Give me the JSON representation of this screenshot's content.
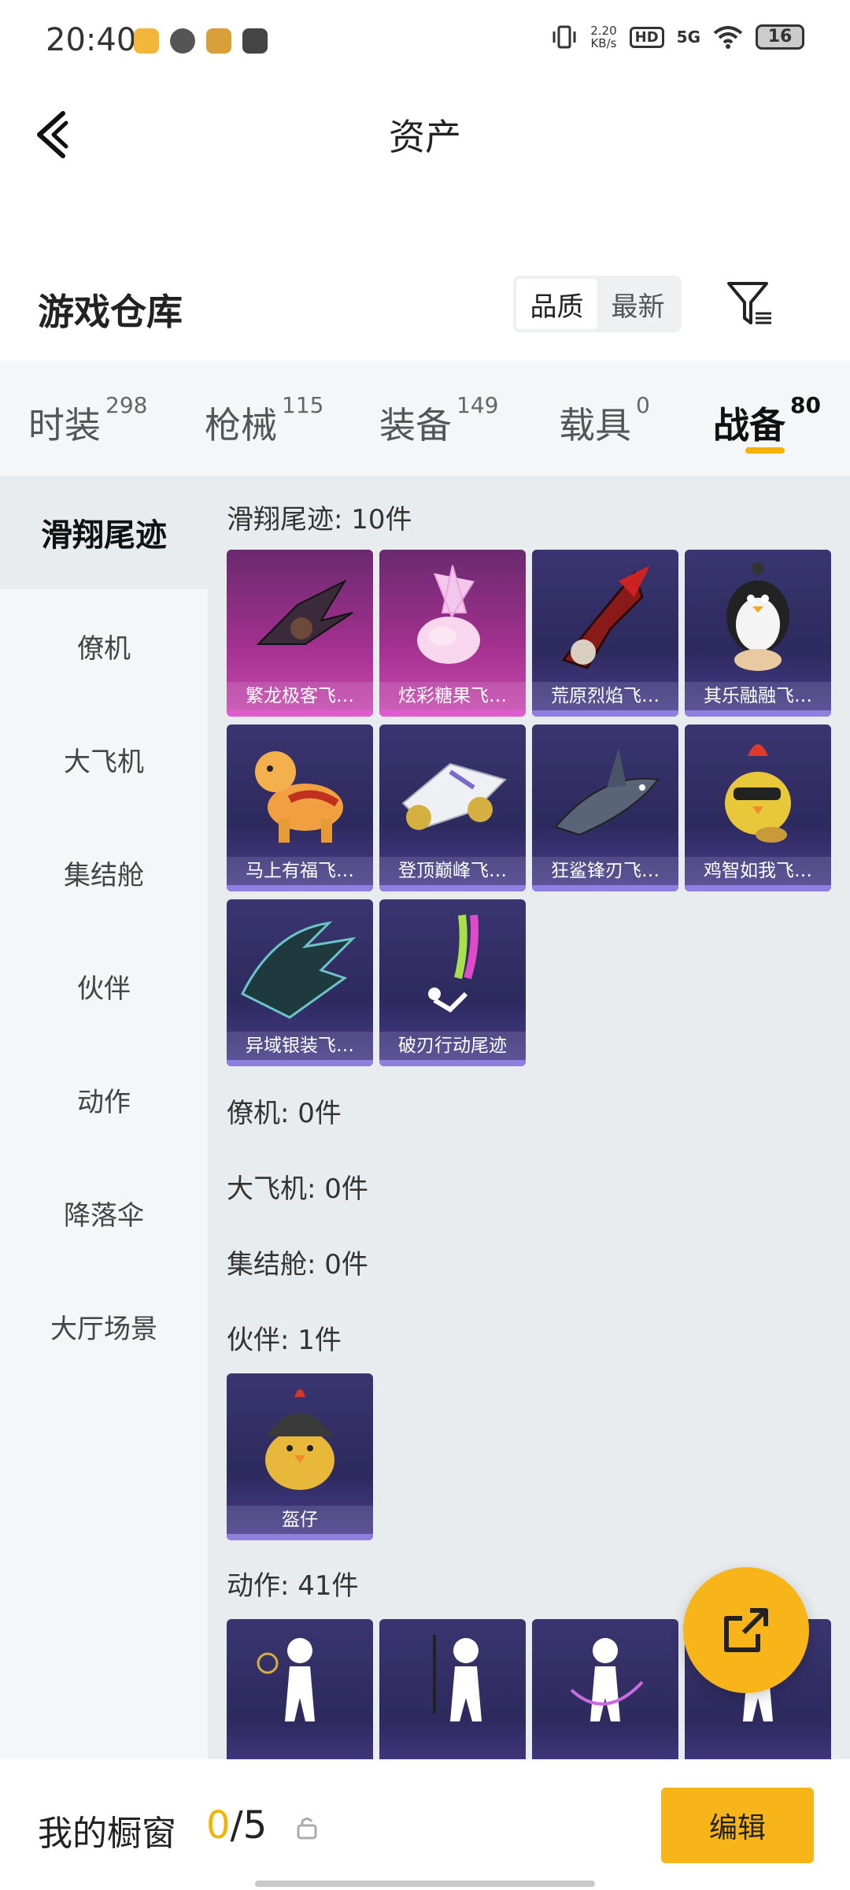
{
  "status_bar": {
    "time": "20:40",
    "speed_value": "2.20",
    "speed_unit": "KB/s",
    "hd": "HD",
    "network": "5G",
    "battery": "16"
  },
  "header": {
    "title": "资产"
  },
  "warehouse": {
    "title": "游戏仓库",
    "sort_options": [
      "品质",
      "最新"
    ],
    "sort_active": "品质"
  },
  "tabs": [
    {
      "label": "时装",
      "count": "298"
    },
    {
      "label": "枪械",
      "count": "115"
    },
    {
      "label": "装备",
      "count": "149"
    },
    {
      "label": "载具",
      "count": "0"
    },
    {
      "label": "战备",
      "count": "80"
    }
  ],
  "active_tab": "战备",
  "sidebar": [
    {
      "label": "滑翔尾迹"
    },
    {
      "label": "僚机"
    },
    {
      "label": "大飞机"
    },
    {
      "label": "集结舱"
    },
    {
      "label": "伙伴"
    },
    {
      "label": "动作"
    },
    {
      "label": "降落伞"
    },
    {
      "label": "大厅场景"
    }
  ],
  "sections": {
    "glide": {
      "heading": "滑翔尾迹: 10件",
      "items": [
        {
          "name": "繁龙极客飞…",
          "rarity": "pink",
          "icon": "dragon-wing-icon"
        },
        {
          "name": "炫彩糖果飞…",
          "rarity": "pink",
          "icon": "candy-icon"
        },
        {
          "name": "荒原烈焰飞…",
          "rarity": "purple",
          "icon": "flame-glider-icon"
        },
        {
          "name": "其乐融融飞…",
          "rarity": "purple",
          "icon": "penguin-icon"
        },
        {
          "name": "马上有福飞…",
          "rarity": "purple",
          "icon": "horse-icon"
        },
        {
          "name": "登顶巅峰飞…",
          "rarity": "purple",
          "icon": "jet-icon"
        },
        {
          "name": "狂鲨锋刃飞…",
          "rarity": "purple",
          "icon": "shark-icon"
        },
        {
          "name": "鸡智如我飞…",
          "rarity": "purple",
          "icon": "chicken-icon"
        },
        {
          "name": "异域银装飞…",
          "rarity": "purple",
          "icon": "silver-wing-icon"
        },
        {
          "name": "破刃行动尾迹",
          "rarity": "purple",
          "icon": "smoke-trail-icon"
        }
      ]
    },
    "wingman": {
      "heading": "僚机: 0件"
    },
    "airplane": {
      "heading": "大飞机: 0件"
    },
    "pod": {
      "heading": "集结舱: 0件"
    },
    "partner": {
      "heading": "伙伴: 1件",
      "items": [
        {
          "name": "盔仔",
          "rarity": "purple",
          "icon": "helmet-chick-icon"
        }
      ]
    },
    "emote": {
      "heading": "动作: 41件",
      "items": [
        {
          "name": "",
          "rarity": "purple",
          "icon": "emote-figure-icon"
        },
        {
          "name": "",
          "rarity": "purple",
          "icon": "emote-figure-icon"
        },
        {
          "name": "",
          "rarity": "purple",
          "icon": "emote-figure-icon"
        },
        {
          "name": "",
          "rarity": "purple",
          "icon": "emote-figure-icon"
        }
      ]
    }
  },
  "showcase": {
    "label": "我的橱窗",
    "current": "0",
    "total": "/5",
    "edit_label": "编辑"
  },
  "colors": {
    "accent": "#f7b51a",
    "purple_card": "#2d2a5e",
    "pink_card": "#a0308e"
  }
}
